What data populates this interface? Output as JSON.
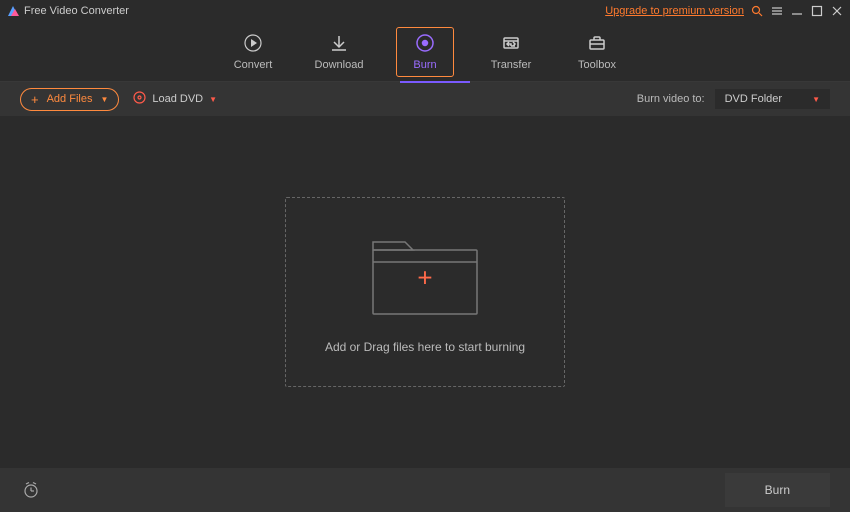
{
  "titlebar": {
    "app_name": "Free Video Converter",
    "upgrade_text": "Upgrade to premium version"
  },
  "tabs": {
    "convert": "Convert",
    "download": "Download",
    "burn": "Burn",
    "transfer": "Transfer",
    "toolbox": "Toolbox",
    "selected": "burn"
  },
  "subbar": {
    "add_files": "Add Files",
    "load_dvd": "Load DVD",
    "burn_to_label": "Burn video to:",
    "burn_to_value": "DVD Folder"
  },
  "dropzone": {
    "text": "Add or Drag files here to start burning"
  },
  "footer": {
    "burn_button": "Burn"
  }
}
